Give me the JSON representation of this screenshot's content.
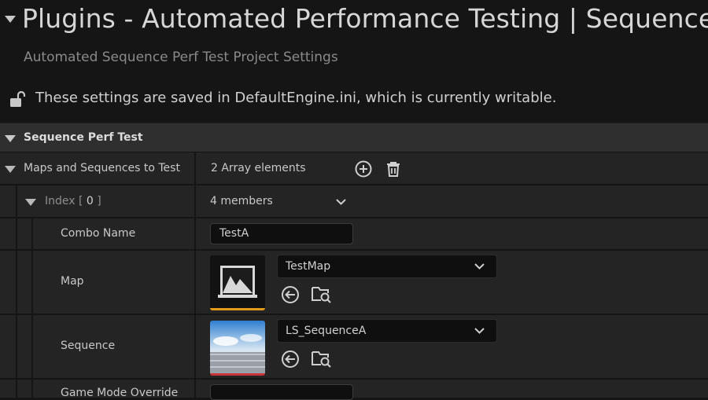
{
  "header": {
    "title": "Plugins - Automated Performance Testing | Sequence",
    "subtitle": "Automated Sequence Perf Test Project Settings",
    "write_note": "These settings are saved in DefaultEngine.ini, which is currently writable."
  },
  "category": {
    "label": "Sequence Perf Test"
  },
  "maps_row": {
    "label": "Maps and Sequences to Test",
    "value": "2 Array elements"
  },
  "index_row": {
    "label": "Index",
    "index_value": "0",
    "value": "4 members"
  },
  "combo_name_row": {
    "label": "Combo Name",
    "value": "TestA"
  },
  "map_row": {
    "label": "Map",
    "selected": "TestMap",
    "accent": "#e39a1b"
  },
  "sequence_row": {
    "label": "Sequence",
    "selected": "LS_SequenceA",
    "accent": "#c8343a"
  },
  "game_mode_row": {
    "label": "Game Mode Override",
    "value": ""
  }
}
